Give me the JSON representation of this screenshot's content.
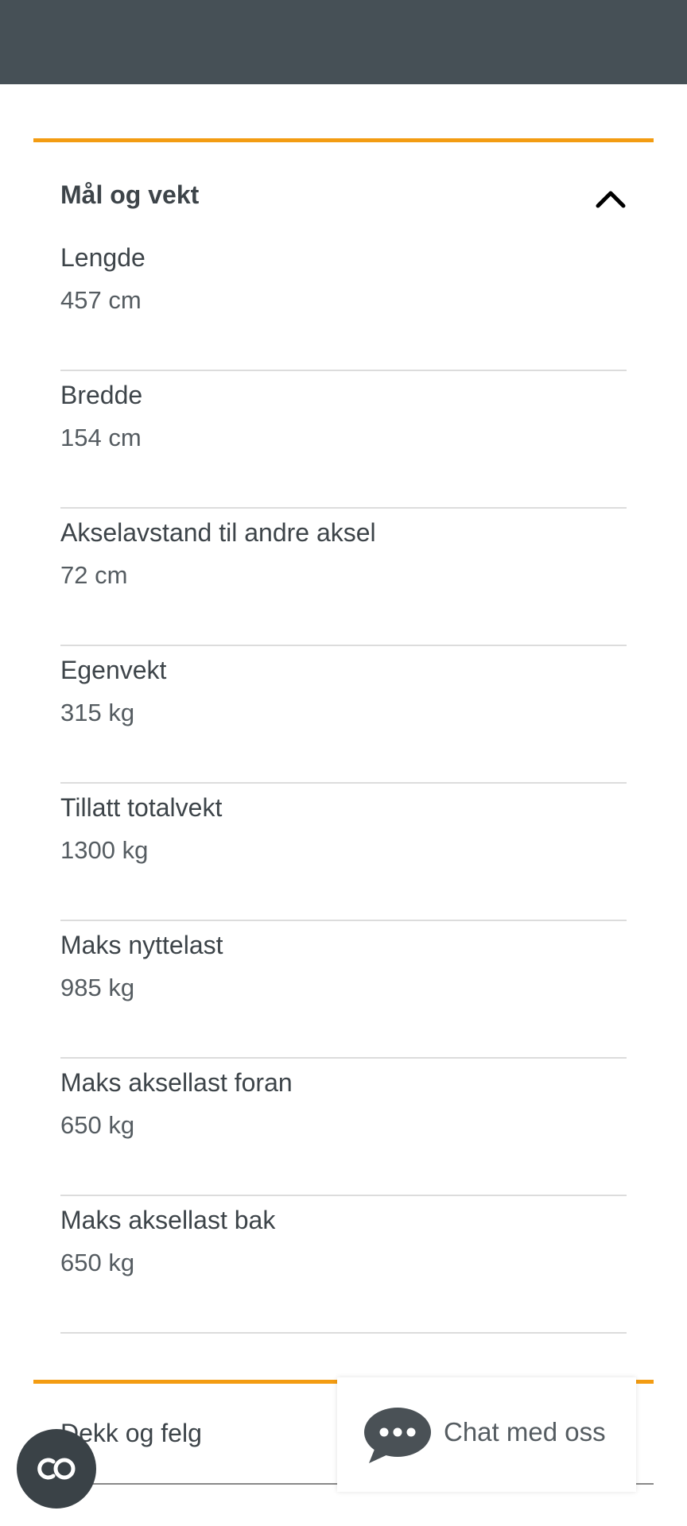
{
  "section": {
    "title": "Mål og vekt",
    "expanded": true,
    "specs": [
      {
        "label": "Lengde",
        "value": "457 cm"
      },
      {
        "label": "Bredde",
        "value": "154 cm"
      },
      {
        "label": "Akselavstand til andre aksel",
        "value": "72 cm"
      },
      {
        "label": "Egenvekt",
        "value": "315 kg"
      },
      {
        "label": "Tillatt totalvekt",
        "value": "1300 kg"
      },
      {
        "label": "Maks nyttelast",
        "value": "985 kg"
      },
      {
        "label": "Maks aksellast foran",
        "value": "650 kg"
      },
      {
        "label": "Maks aksellast bak",
        "value": "650 kg"
      }
    ]
  },
  "next_section": {
    "title": "Dekk og felg"
  },
  "chat": {
    "label": "Chat med oss",
    "icon": "chat-bubble-icon"
  },
  "floating_button": {
    "icon": "co-icon",
    "text": "CO"
  },
  "colors": {
    "accent": "#f39c12",
    "topbar": "#465056"
  }
}
